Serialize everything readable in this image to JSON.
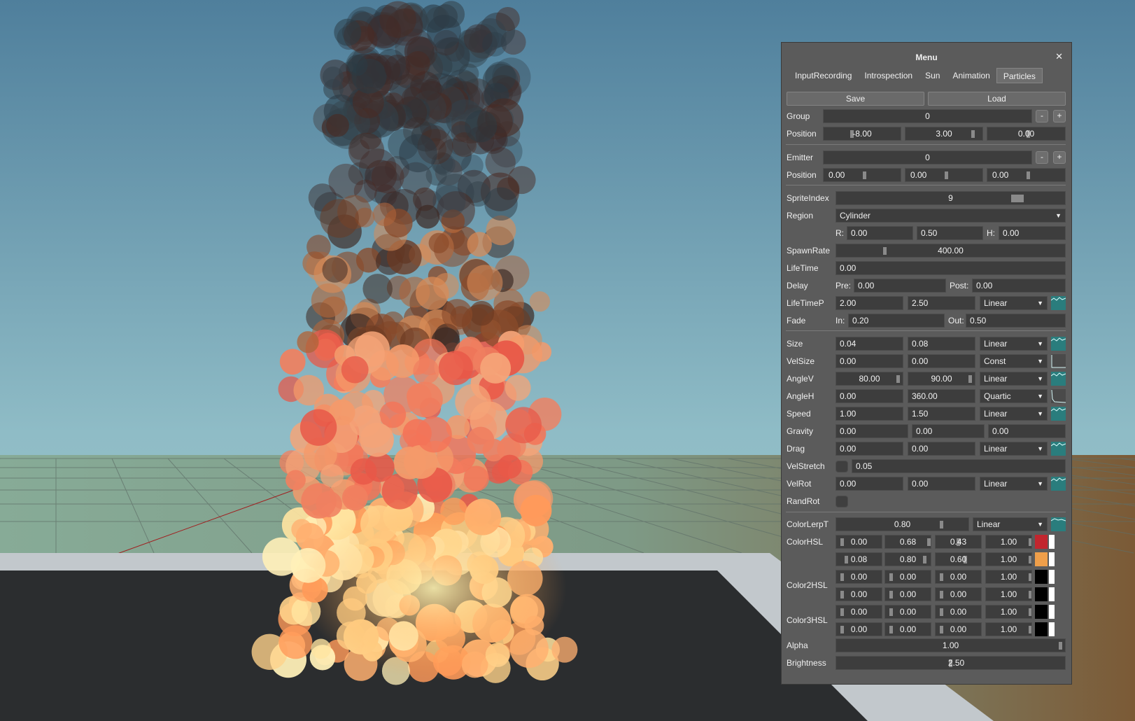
{
  "menu": {
    "title": "Menu",
    "close_glyph": "✕",
    "tabs": [
      "InputRecording",
      "Introspection",
      "Sun",
      "Animation",
      "Particles"
    ],
    "active_tab": "Particles",
    "save_label": "Save",
    "load_label": "Load",
    "minus": "-",
    "plus": "+",
    "group": {
      "label": "Group",
      "value": "0"
    },
    "group_position": {
      "label": "Position",
      "x": "-8.00",
      "y": "3.00",
      "z": "0.00"
    },
    "emitter": {
      "label": "Emitter",
      "value": "0"
    },
    "emitter_position": {
      "label": "Position",
      "x": "0.00",
      "y": "0.00",
      "z": "0.00"
    },
    "sprite_index": {
      "label": "SpriteIndex",
      "value": "9"
    },
    "region": {
      "label": "Region",
      "value": "Cylinder",
      "r_label": "R:",
      "r": "0.00",
      "mid": "0.50",
      "h_label": "H:",
      "h": "0.00"
    },
    "spawn_rate": {
      "label": "SpawnRate",
      "value": "400.00"
    },
    "lifetime": {
      "label": "LifeTime",
      "value": "0.00"
    },
    "delay": {
      "label": "Delay",
      "pre_label": "Pre:",
      "pre": "0.00",
      "post_label": "Post:",
      "post": "0.00"
    },
    "lifetime_p": {
      "label": "LifeTimeP",
      "min": "2.00",
      "max": "2.50",
      "mode": "Linear",
      "curve": "wave"
    },
    "fade": {
      "label": "Fade",
      "in_label": "In:",
      "in": "0.20",
      "out_label": "Out:",
      "out": "0.50"
    },
    "size": {
      "label": "Size",
      "min": "0.04",
      "max": "0.08",
      "mode": "Linear",
      "curve": "wave"
    },
    "vel_size": {
      "label": "VelSize",
      "min": "0.00",
      "max": "0.00",
      "mode": "Const",
      "curve": "const"
    },
    "angle_v": {
      "label": "AngleV",
      "min": "80.00",
      "max": "90.00",
      "mode": "Linear",
      "curve": "wave"
    },
    "angle_h": {
      "label": "AngleH",
      "min": "0.00",
      "max": "360.00",
      "mode": "Quartic",
      "curve": "quartic"
    },
    "speed": {
      "label": "Speed",
      "min": "1.00",
      "max": "1.50",
      "mode": "Linear",
      "curve": "wave"
    },
    "gravity": {
      "label": "Gravity",
      "x": "0.00",
      "y": "0.00",
      "z": "0.00"
    },
    "drag": {
      "label": "Drag",
      "min": "0.00",
      "max": "0.00",
      "mode": "Linear",
      "curve": "wave"
    },
    "vel_stretch": {
      "label": "VelStretch",
      "value": "0.05"
    },
    "vel_rot": {
      "label": "VelRot",
      "min": "0.00",
      "max": "0.00",
      "mode": "Linear",
      "curve": "wave"
    },
    "rand_rot": {
      "label": "RandRot"
    },
    "color_lerp_t": {
      "label": "ColorLerpT",
      "value": "0.80",
      "mode": "Linear",
      "curve": "wave"
    },
    "color_hsl": {
      "label": "ColorHSL",
      "rows": [
        {
          "h": "0.00",
          "s": "0.68",
          "l": "0.43",
          "a": "1.00",
          "swatch": "#c2262e"
        },
        {
          "h": "0.08",
          "s": "0.80",
          "l": "0.60",
          "a": "1.00",
          "swatch": "#ef9f4a"
        }
      ]
    },
    "color2_hsl": {
      "label": "Color2HSL",
      "rows": [
        {
          "h": "0.00",
          "s": "0.00",
          "l": "0.00",
          "a": "1.00",
          "swatch": "#000000"
        },
        {
          "h": "0.00",
          "s": "0.00",
          "l": "0.00",
          "a": "1.00",
          "swatch": "#000000"
        }
      ]
    },
    "color3_hsl": {
      "label": "Color3HSL",
      "rows": [
        {
          "h": "0.00",
          "s": "0.00",
          "l": "0.00",
          "a": "1.00",
          "swatch": "#000000"
        },
        {
          "h": "0.00",
          "s": "0.00",
          "l": "0.00",
          "a": "1.00",
          "swatch": "#000000"
        }
      ]
    },
    "alpha": {
      "label": "Alpha",
      "value": "1.00"
    },
    "brightness": {
      "label": "Brightness",
      "value": "2.50"
    }
  },
  "colors": {
    "panel_bg": "#5b5b5b",
    "field_bg": "#3d3d3d",
    "curve_bg": "#2a7d7d",
    "sky_top": "#5d8aa6",
    "sky_bottom": "#9fc9c8",
    "ground": "#2b2d2f"
  }
}
